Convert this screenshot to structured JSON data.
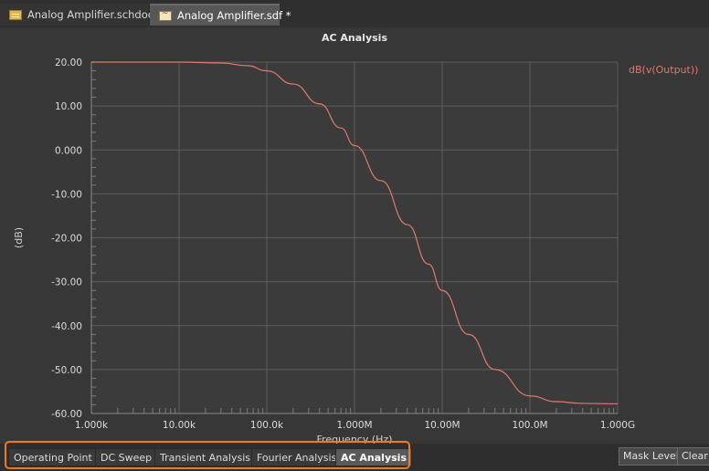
{
  "doc_tabs": [
    {
      "label": "Analog Amplifier.schdoc",
      "icon": "schematic-document-icon"
    },
    {
      "label": "Analog Amplifier.sdf *",
      "icon": "simulation-data-icon"
    }
  ],
  "chart": {
    "title": "AC Analysis",
    "ylabel": "(dB)",
    "xlabel": "Frequency (Hz)",
    "legend": "dB(v(Output))"
  },
  "chart_data": {
    "type": "line",
    "title": "AC Analysis",
    "xlabel": "Frequency (Hz)",
    "ylabel": "(dB)",
    "x_scale": "log",
    "xlim": [
      1000,
      1000000000
    ],
    "ylim": [
      -60,
      20
    ],
    "x_tick_labels": [
      "1.000k",
      "10.00k",
      "100.0k",
      "1.000M",
      "10.00M",
      "100.0M",
      "1.000G"
    ],
    "y_tick_labels": [
      "20.00",
      "10.00",
      "0.000",
      "-10.00",
      "-20.00",
      "-30.00",
      "-40.00",
      "-50.00",
      "-60.00"
    ],
    "y_ticks": [
      20,
      10,
      0,
      -10,
      -20,
      -30,
      -40,
      -50,
      -60
    ],
    "grid": true,
    "legend_position": "top-right",
    "series": [
      {
        "name": "dB(v(Output))",
        "color": "#e07a6a",
        "x": [
          1000,
          10000,
          30000,
          60000,
          100000,
          200000,
          400000,
          700000,
          1000000,
          2000000,
          4000000,
          7000000,
          10000000,
          20000000,
          40000000,
          100000000,
          200000000,
          400000000,
          1000000000
        ],
        "y": [
          20.0,
          20.0,
          19.8,
          19.2,
          18.0,
          15.0,
          10.5,
          5.0,
          1.0,
          -7.0,
          -17.0,
          -26.0,
          -32.0,
          -42.0,
          -50.0,
          -56.0,
          -57.3,
          -57.7,
          -57.8
        ]
      }
    ]
  },
  "bottom_tabs": [
    {
      "label": "Operating Point",
      "active": false
    },
    {
      "label": "DC Sweep",
      "active": false
    },
    {
      "label": "Transient Analysis",
      "active": false
    },
    {
      "label": "Fourier Analysis",
      "active": false
    },
    {
      "label": "AC Analysis",
      "active": true
    }
  ],
  "right_buttons": {
    "mask_level": "Mask Level",
    "clear": "Clear"
  },
  "colors": {
    "trace": "#e07a6a",
    "highlight": "#f07a20",
    "grid": "#5a5a5a"
  }
}
